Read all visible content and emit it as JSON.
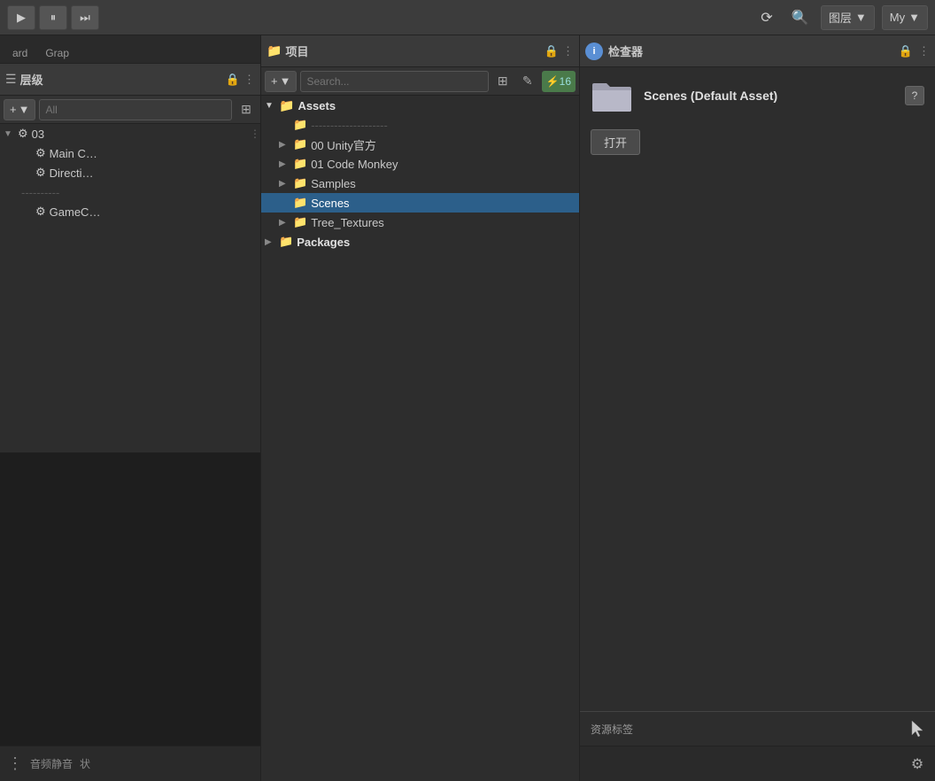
{
  "topbar": {
    "play_label": "▶",
    "pause_label": "⏸",
    "step_label": "⏭",
    "history_icon": "↺",
    "search_icon": "🔍",
    "layer_label": "图层",
    "layer_dropdown": "▼",
    "my_label": "My",
    "my_dropdown": "▼"
  },
  "tabs": {
    "tab1": "ard",
    "tab2": "Grap"
  },
  "hierarchy": {
    "panel_title": "层级",
    "lock_icon": "🔒",
    "dots_icon": "⋮",
    "add_label": "+",
    "add_arrow": "▼",
    "search_placeholder": "All",
    "items": [
      {
        "id": "03",
        "label": "03",
        "indent": 0,
        "has_arrow": true,
        "arrow_dir": "▼",
        "icon": "⚙"
      },
      {
        "id": "main_camera",
        "label": "Main C…",
        "indent": 1,
        "has_arrow": false,
        "icon": "⚙"
      },
      {
        "id": "directional",
        "label": "Directi…",
        "indent": 1,
        "has_arrow": false,
        "icon": "⚙"
      },
      {
        "id": "separator",
        "label": "----------",
        "indent": 1,
        "has_arrow": false,
        "icon": ""
      },
      {
        "id": "gamec",
        "label": "GameC…",
        "indent": 1,
        "has_arrow": false,
        "icon": "⚙"
      }
    ]
  },
  "project": {
    "panel_title": "项目",
    "lock_icon": "🔒",
    "dots_icon": "⋮",
    "add_label": "+",
    "add_arrow": "▼",
    "search_icon": "🔍",
    "badge": "16",
    "toolbar_icons": [
      "↑",
      "✎",
      "⚡"
    ],
    "tree": [
      {
        "id": "assets",
        "label": "Assets",
        "indent": 0,
        "has_arrow": true,
        "arrow_dir": "▼",
        "icon": "📁",
        "selected": false
      },
      {
        "id": "dotted",
        "label": "--------------------",
        "indent": 1,
        "has_arrow": false,
        "arrow_dir": "",
        "icon": "📁",
        "selected": false
      },
      {
        "id": "unity",
        "label": "00 Unity官方",
        "indent": 1,
        "has_arrow": true,
        "arrow_dir": "▶",
        "icon": "📁",
        "selected": false
      },
      {
        "id": "codemonkey",
        "label": "01 Code Monkey",
        "indent": 1,
        "has_arrow": true,
        "arrow_dir": "▶",
        "icon": "📁",
        "selected": false
      },
      {
        "id": "samples",
        "label": "Samples",
        "indent": 1,
        "has_arrow": true,
        "arrow_dir": "▶",
        "icon": "📁",
        "selected": false
      },
      {
        "id": "scenes",
        "label": "Scenes",
        "indent": 1,
        "has_arrow": false,
        "arrow_dir": "",
        "icon": "📁",
        "selected": true
      },
      {
        "id": "tree_textures",
        "label": "Tree_Textures",
        "indent": 1,
        "has_arrow": true,
        "arrow_dir": "▶",
        "icon": "📁",
        "selected": false
      },
      {
        "id": "packages",
        "label": "Packages",
        "indent": 0,
        "has_arrow": true,
        "arrow_dir": "▶",
        "icon": "📁",
        "selected": false
      }
    ]
  },
  "inspector": {
    "panel_title": "检查器",
    "info_label": "i",
    "lock_icon": "🔒",
    "dots_icon": "⋮",
    "help_label": "?",
    "asset_name": "Scenes (Default Asset)",
    "open_button": "打开",
    "asset_tag_label": "资源标签"
  }
}
